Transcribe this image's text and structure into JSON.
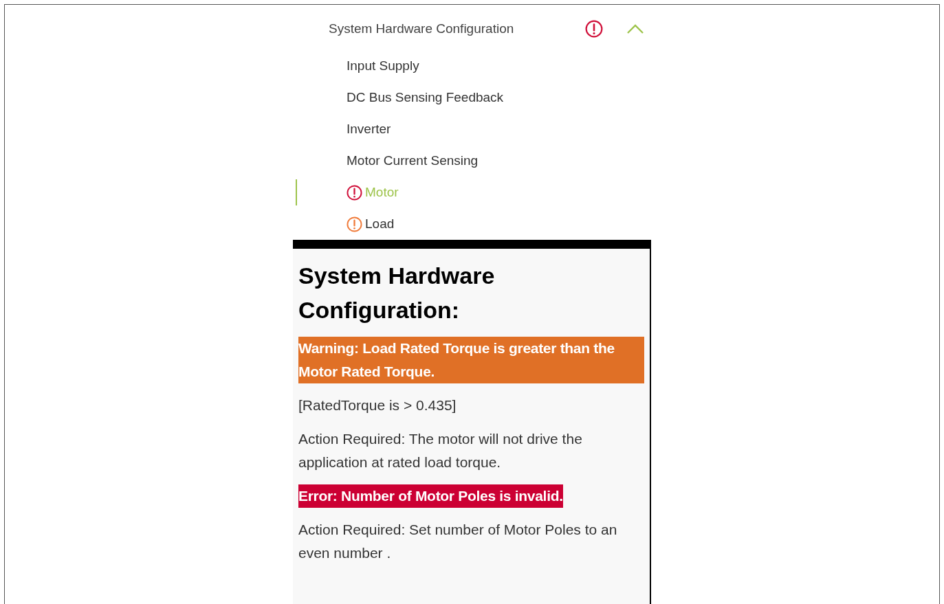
{
  "nav": {
    "title": "System Hardware Configuration",
    "color": "#d0103a",
    "expanded": true,
    "items": [
      {
        "label": "Input Supply",
        "selected": false
      },
      {
        "label": "DC Bus Sensing Feedback",
        "selected": false
      },
      {
        "label": "Inverter",
        "selected": false
      },
      {
        "label": "Motor Current Sensing",
        "selected": false
      },
      {
        "label": "Motor",
        "selected": true,
        "color": "#d0103a"
      },
      {
        "label": "Load",
        "selected": false,
        "color": "#f07b3a"
      }
    ]
  },
  "panel": {
    "title": "System Hardware Configuration:",
    "messages": [
      {
        "kind": "warning",
        "text": "Warning: Load Rated Torque is greater than the Motor Rated Torque."
      },
      {
        "kind": "plain",
        "text": "[RatedTorque is > 0.435]"
      },
      {
        "kind": "plain",
        "text": "Action Required: The motor will not drive the application at rated load torque."
      },
      {
        "kind": "error",
        "text": "Error: Number of Motor Poles is invalid."
      },
      {
        "kind": "plain",
        "text": "Action Required: Set number of Motor Poles to an even number ."
      }
    ]
  }
}
